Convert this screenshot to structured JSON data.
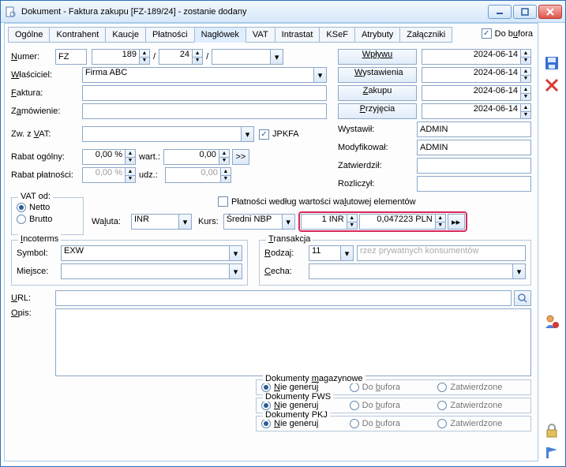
{
  "window": {
    "title": "Dokument - Faktura zakupu [FZ-189/24]  - zostanie dodany"
  },
  "tabs": [
    "Ogólne",
    "Kontrahent",
    "Kaucje",
    "Płatności",
    "Nagłówek",
    "VAT",
    "Intrastat",
    "KSeF",
    "Atrybuty",
    "Załączniki"
  ],
  "header": {
    "do_bufora": "Do bufora"
  },
  "left": {
    "numer_lbl": "Numer:",
    "numer_series": "FZ",
    "numer_n": "189",
    "numer_y": "24",
    "slash": "/",
    "wlasciciel_lbl": "Właściciel:",
    "wlasciciel": "Firma ABC",
    "faktura_lbl": "Faktura:",
    "zamowienie_lbl": "Zamówienie:",
    "zw_vat_lbl": "Zw. z VAT:",
    "jpkfa": "JPKFA",
    "rabat_ogolny_lbl": "Rabat ogólny:",
    "rabat_ogolny_v": "0,00 %",
    "wart_lbl": "wart.:",
    "wart_v": "0,00",
    "arrow": ">>",
    "rabat_plat_lbl": "Rabat płatności:",
    "rabat_plat_v": "0,00 %",
    "udz_lbl": "udz.:",
    "udz_v": "0,00",
    "vat_od": "VAT od:",
    "netto": "Netto",
    "brutto": "Brutto",
    "plat_checkbox": "Płatności według wartości walutowej elementów",
    "waluta_lbl": "Waluta:",
    "waluta": "INR",
    "kurs_lbl": "Kurs:",
    "kurs": "Średni NBP",
    "rate_from": "1 INR",
    "rate_to": "0,047223 PLN",
    "incoterms": "Incoterms",
    "symbol_lbl": "Symbol:",
    "symbol": "EXW",
    "miejsce_lbl": "Miejsce:",
    "transakcja": "Transakcja",
    "rodzaj_lbl": "Rodzaj:",
    "rodzaj": "11",
    "rodzaj_ph": "rzez prywatnych konsumentów",
    "cecha_lbl": "Cecha:",
    "url_lbl": "URL:",
    "opis_lbl": "Opis:"
  },
  "right": {
    "wplywu": "Wpływu",
    "wplywu_d": "2024-06-14",
    "wystawienia": "Wystawienia",
    "wystawienia_d": "2024-06-14",
    "zakupu": "Zakupu",
    "zakupu_d": "2024-06-14",
    "przyjecia": "Przyjęcia",
    "przyjecia_d": "2024-06-14",
    "wystawil": "Wystawił:",
    "wystawil_v": "ADMIN",
    "modyfikowal": "Modyfikował:",
    "modyfikowal_v": "ADMIN",
    "zatwierdzil": "Zatwierdził:",
    "rozliczyl": "Rozliczył:"
  },
  "docgen": {
    "mag": "Dokumenty magazynowe",
    "fws": "Dokumenty FWS",
    "pkj": "Dokumenty PKJ",
    "opt1": "Nie generuj",
    "opt2": "Do bufora",
    "opt3": "Zatwierdzone"
  }
}
